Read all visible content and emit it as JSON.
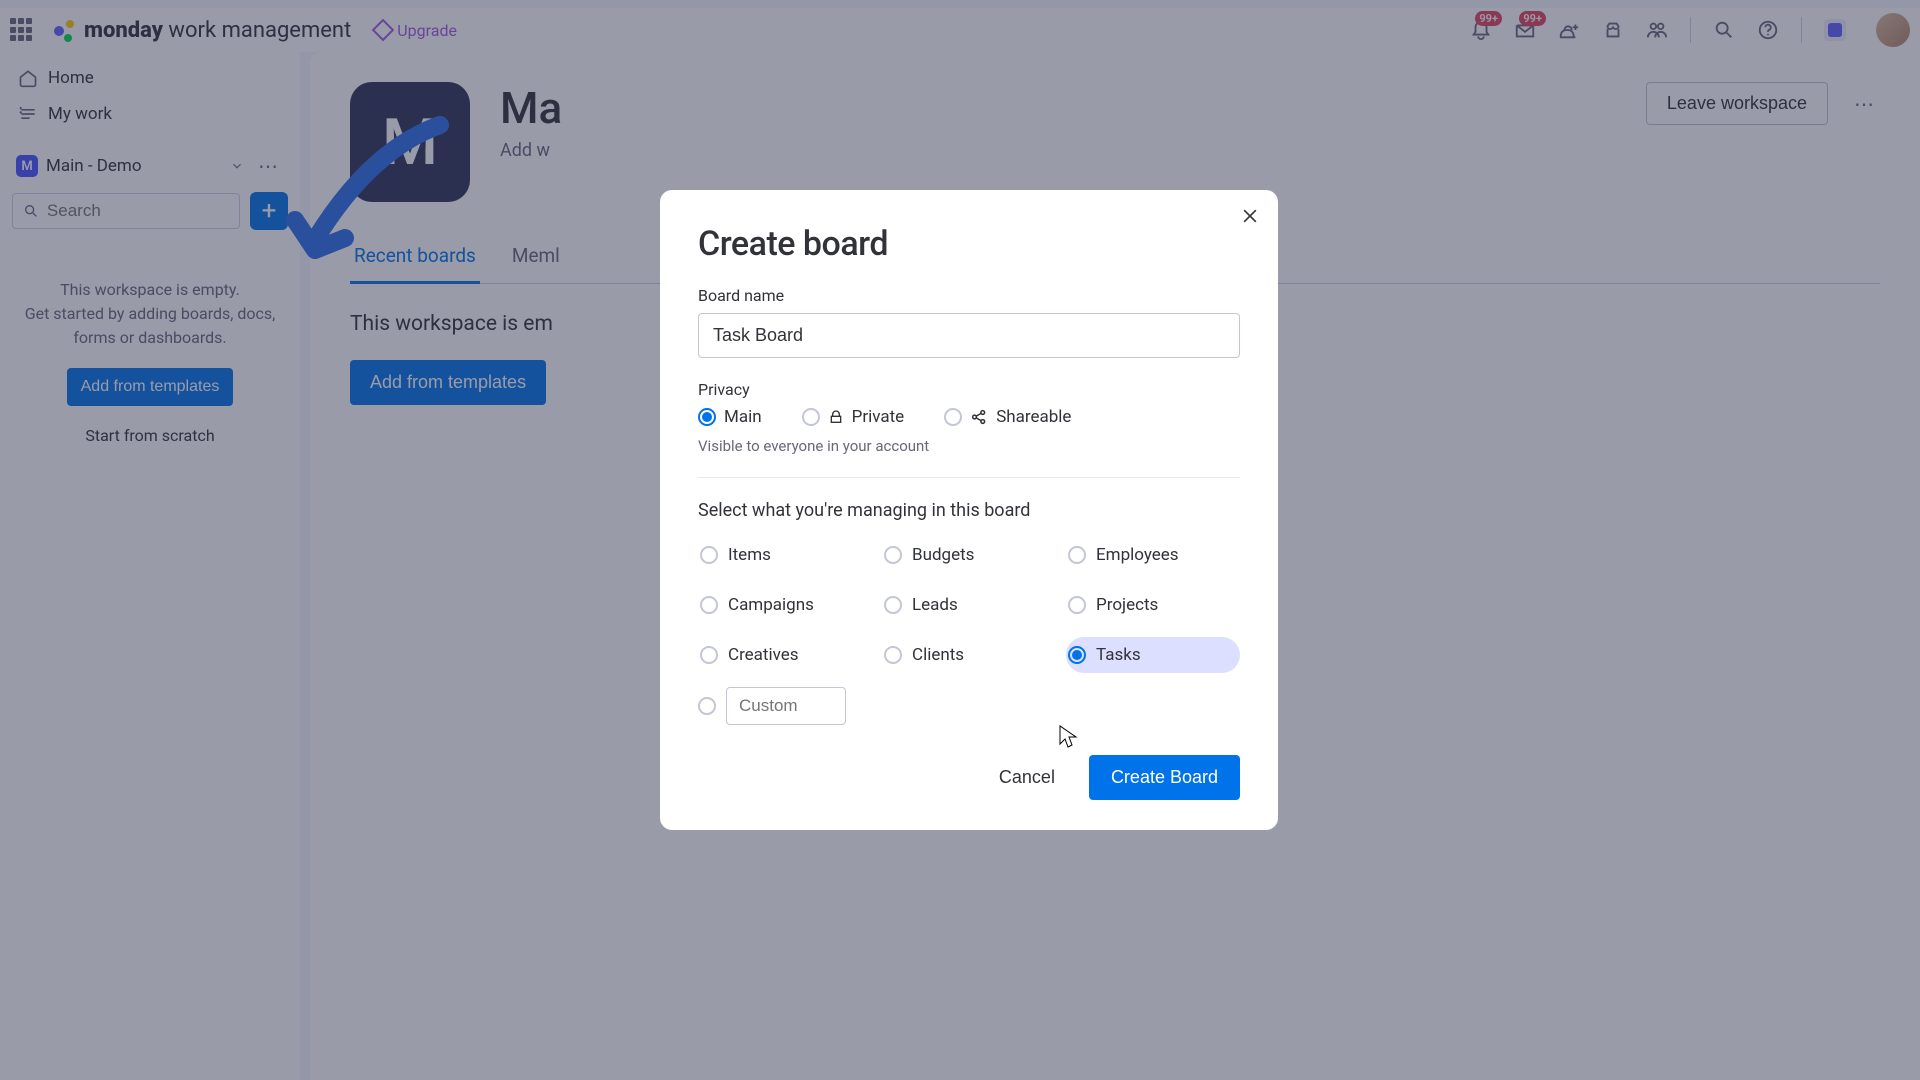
{
  "header": {
    "brand_bold": "monday",
    "brand_rest": " work management",
    "upgrade": "Upgrade",
    "notif_badge": "99+",
    "inbox_badge": "99+"
  },
  "nav": {
    "home": "Home",
    "mywork": "My work",
    "workspace": "Main - Demo",
    "search_placeholder": "Search",
    "empty1": "This workspace is empty.",
    "empty2": "Get started by adding boards, docs, forms or dashboards.",
    "add_templates": "Add from templates",
    "scratch": "Start from scratch"
  },
  "main": {
    "ws_letter": "M",
    "ws_title": "Ma",
    "ws_sub": "Add w",
    "leave": "Leave workspace",
    "tab_recent": "Recent boards",
    "tab_members": "Meml",
    "empty": "This workspace is em",
    "add_templates": "Add from templates"
  },
  "modal": {
    "title": "Create board",
    "name_label": "Board name",
    "name_value": "Task Board",
    "privacy_label": "Privacy",
    "privacy": {
      "main": "Main",
      "private": "Private",
      "shareable": "Shareable",
      "hint": "Visible to everyone in your account"
    },
    "manage_label": "Select what you're managing in this board",
    "manage": {
      "items": "Items",
      "campaigns": "Campaigns",
      "creatives": "Creatives",
      "budgets": "Budgets",
      "leads": "Leads",
      "clients": "Clients",
      "employees": "Employees",
      "projects": "Projects",
      "tasks": "Tasks",
      "custom_placeholder": "Custom"
    },
    "cancel": "Cancel",
    "create": "Create Board"
  }
}
